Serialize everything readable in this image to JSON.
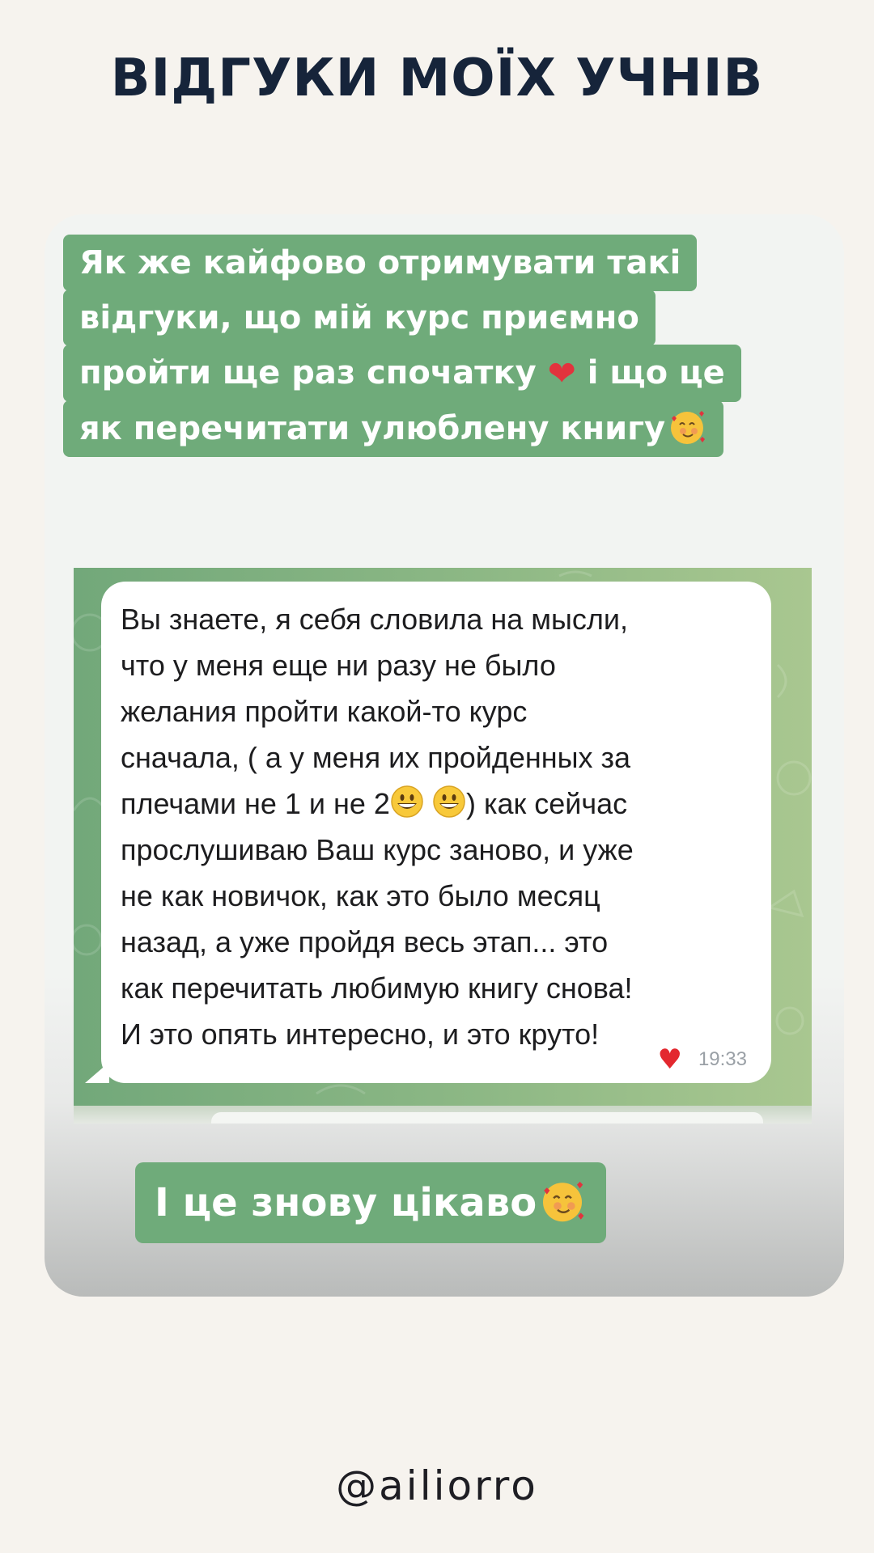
{
  "title": "ВІДГУКИ МОЇХ УЧНІВ",
  "highlight": {
    "lines": [
      "Як же кайфово отримувати такі",
      "відгуки, що мій курс приємно",
      "пройти ще раз спочатку",
      "і що це",
      "як перечитати улюблену книгу"
    ],
    "icons": [
      "red-heart-icon",
      "smiling-face-with-hearts-icon"
    ]
  },
  "message": {
    "lines": [
      "Вы знаете, я себя словила на мысли,",
      "что у меня еще ни разу не было",
      "желания пройти какой-то курс",
      "сначала, ( а у меня их пройденных за",
      "плечами не 1 и не 2",
      ") как сейчас",
      "прослушиваю Ваш курс заново, и уже",
      "не как новичок, как это было месяц",
      "назад, а уже пройдя весь этап... это",
      "как перечитать любимую книгу снова!",
      "И это опять интересно, и это круто!"
    ],
    "time": "19:33",
    "icons": [
      "grinning-face-icon",
      "reaction-heart-icon"
    ]
  },
  "bottom_highlight": "І це знову цікаво",
  "handle": "@ailiorro",
  "colors": {
    "background": "#f6f3ee",
    "title": "#16243a",
    "highlight_green": "#6fab7a",
    "chat_background_green": "#8db885",
    "heart_red": "#e2333d"
  }
}
